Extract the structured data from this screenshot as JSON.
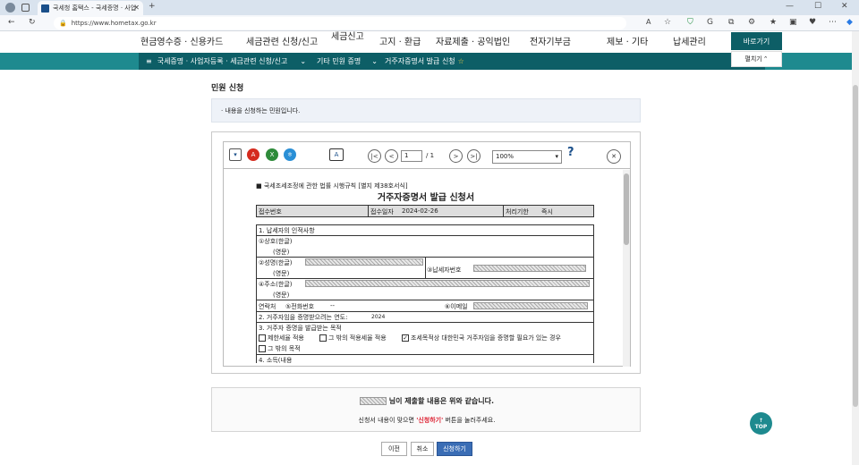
{
  "browser": {
    "tab_title": "국세청 홈택스 - 국세증명 · 사업",
    "url": "https://www.hometax.go.kr"
  },
  "topnav": {
    "items": [
      "현금영수증 · 신용카드",
      "세금관련 신청/신고",
      "세금신고",
      "고지 · 환급",
      "자료제출 · 공익법인",
      "전자기부금",
      "제보 · 기타",
      "납세관리"
    ],
    "right_button": "바로가기",
    "dropdown": "펼치기"
  },
  "breadcrumb": {
    "menu_label": "≡",
    "items": [
      "국세증명 · 사업자등록 · 세금관련 신청/신고",
      "기타 민원 증명",
      "거주자증명서 발급 신청"
    ],
    "star": "☆"
  },
  "page": {
    "title": "민원 신청",
    "notice": "· 내용을 신청하는 민원입니다."
  },
  "viewer": {
    "page_current": "1",
    "page_total": "/ 1",
    "zoom": "100%"
  },
  "document": {
    "form_ref": "■ 국세조세조정에 관한 법률 시행규칙 [별지 제38호서식]",
    "title": "거주자증명서 발급 신청서",
    "receipt_no_label": "접수번호",
    "receipt_date_label": "접수일자",
    "receipt_date": "2024-02-26",
    "processing_label": "처리기한",
    "processing_value": "즉시",
    "section1": "1. 납세자의 인적사항",
    "name_label": "①상호(한글)",
    "english": "(영문)",
    "person_label": "②성명(한글)",
    "taxpayer_no": "③납세자번호",
    "address_label": "④주소(한글)",
    "contact": "연락처",
    "phone_label": "⑤전화번호",
    "phone_value": "--",
    "email_label": "⑥이메일",
    "section2": "2. 거주자임을 증명받으려는 연도:",
    "year": "2024",
    "section3": "3. 거주자 증명을 발급받는 목적",
    "purpose1": "제한세율 적용",
    "purpose2": "그 밖의 적용세율 적용",
    "purpose3": "조세목적상 대한민국 거주자임을 증명할 필요가 있는 경우",
    "purpose4": "그 밖의 목적",
    "section4": "4. 소득(내용"
  },
  "declare": {
    "line1": "님이 제출할 내용은 위와 같습니다.",
    "line2_pre": "신청서 내용이 맞으면",
    "line2_btn": "'신청하기'",
    "line2_post": "버튼을 눌러주세요."
  },
  "buttons": {
    "prev": "이전",
    "cancel": "취소",
    "submit": "신청하기"
  },
  "top_button": "TOP",
  "colors": {
    "teal": "#1e8a8f",
    "dark_teal": "#0d5e66",
    "submit_blue": "#3a6db5"
  }
}
